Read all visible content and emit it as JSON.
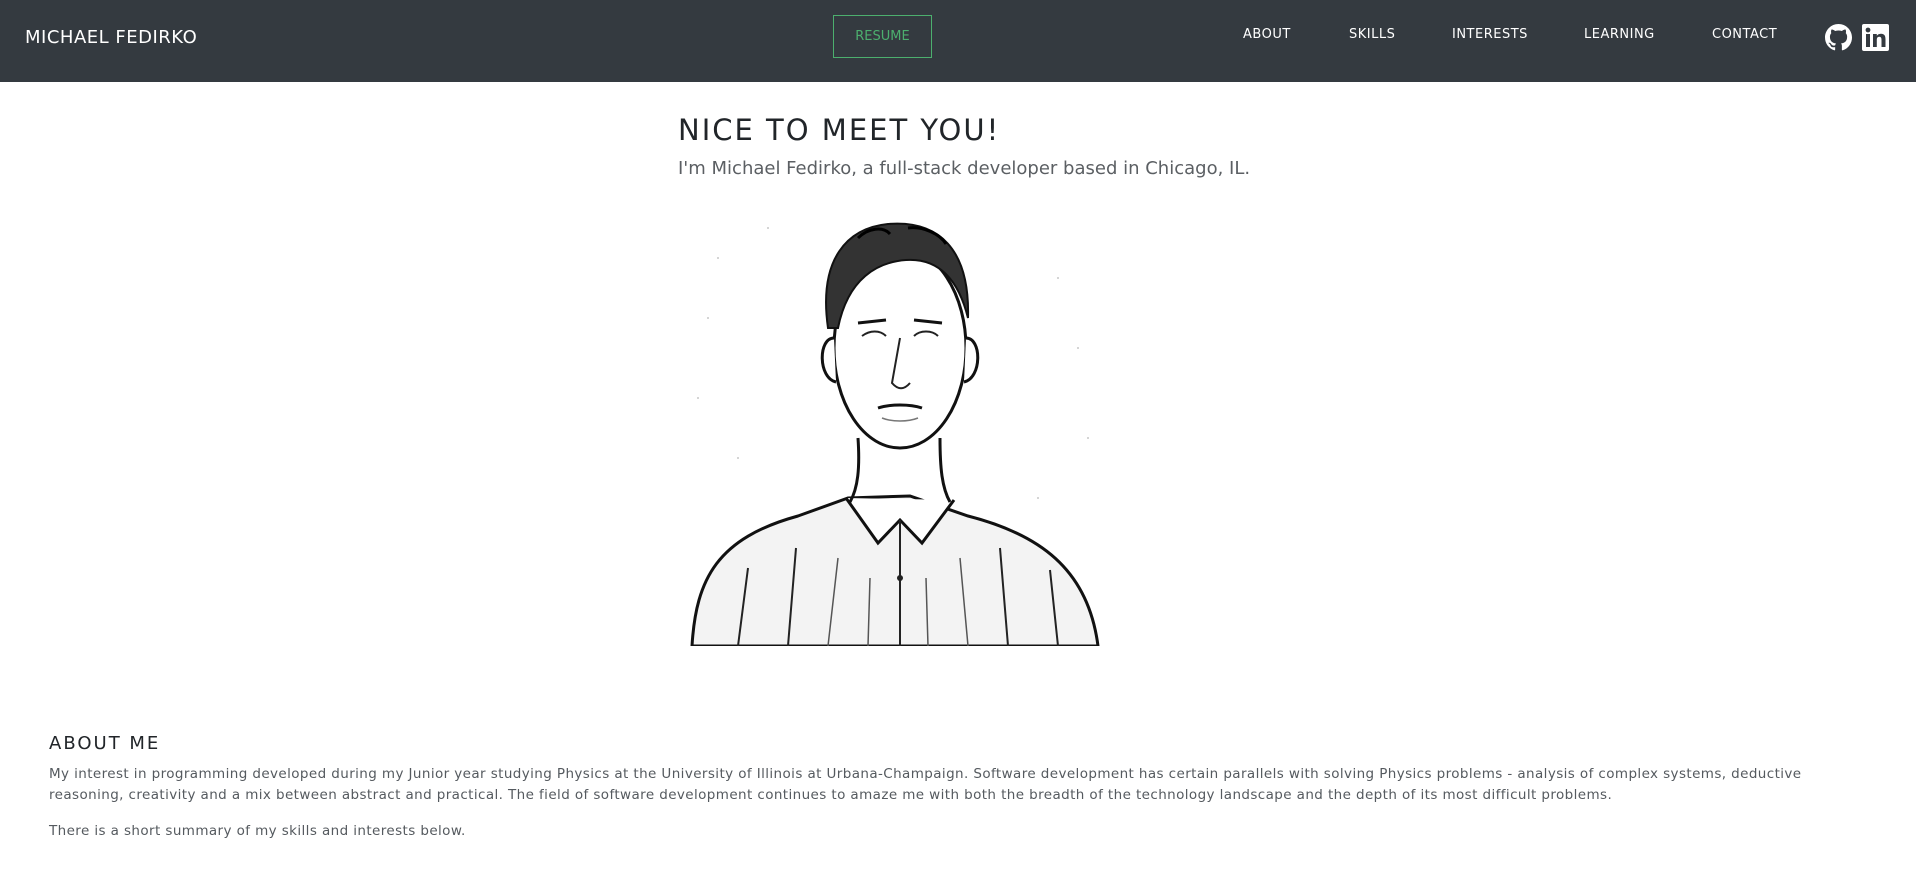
{
  "nav": {
    "brand": "MICHAEL FEDIRKO",
    "resume_label": "RESUME",
    "links": [
      "ABOUT",
      "SKILLS",
      "INTERESTS",
      "LEARNING",
      "CONTACT"
    ],
    "social_icons": [
      "github-icon",
      "linkedin-icon"
    ]
  },
  "hero": {
    "title": "NICE TO MEET YOU!",
    "subtitle": "I'm Michael Fedirko, a full-stack developer based in Chicago, IL."
  },
  "about": {
    "title": "ABOUT ME",
    "paragraph1": "My interest in programming developed during my Junior year studying Physics at the University of Illinois at Urbana-Champaign. Software development has certain parallels with solving Physics problems - analysis of complex systems, deductive reasoning, creativity and a mix between abstract and practical. The field of software development continues to amaze me with both the breadth of the technology landscape and the depth of its most difficult problems.",
    "paragraph2": "There is a short summary of my skills and interests below."
  },
  "colors": {
    "navbar_bg": "#343a40",
    "resume_accent": "#4caf6e"
  }
}
